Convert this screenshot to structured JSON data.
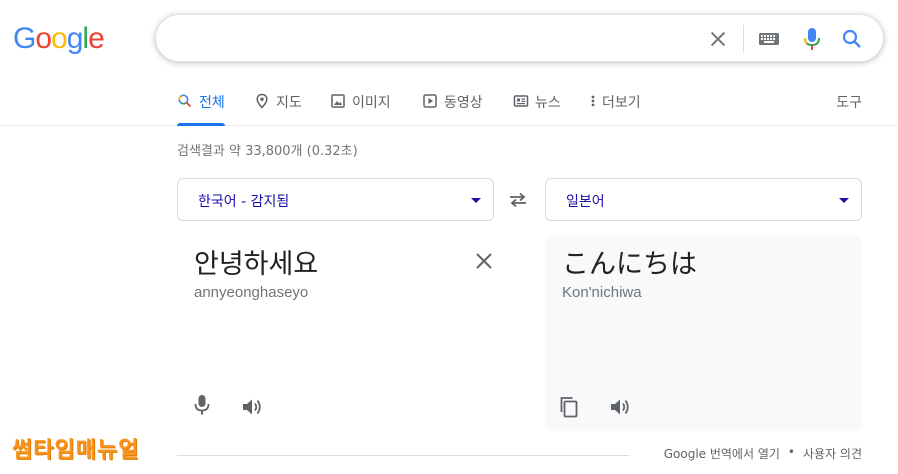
{
  "logo": {
    "letters": [
      "G",
      "o",
      "o",
      "g",
      "l",
      "e"
    ],
    "colors": [
      "#4285F4",
      "#EA4335",
      "#FBBC05",
      "#4285F4",
      "#34A853",
      "#EA4335"
    ]
  },
  "search": {
    "value": "",
    "placeholder": ""
  },
  "tabs": [
    {
      "label": "전체",
      "icon": "search-icon",
      "active": true
    },
    {
      "label": "지도",
      "icon": "map-pin-icon"
    },
    {
      "label": "이미지",
      "icon": "image-icon"
    },
    {
      "label": "동영상",
      "icon": "video-icon"
    },
    {
      "label": "뉴스",
      "icon": "news-icon"
    },
    {
      "label": "더보기",
      "icon": "more-icon"
    }
  ],
  "tools_label": "도구",
  "result_stats": "검색결과 약 33,800개 (0.32초)",
  "translator": {
    "source_lang": "한국어 - 감지됨",
    "target_lang": "일본어",
    "source_text": "안녕하세요",
    "source_romanization": "annyeonghaseyo",
    "target_text": "こんにちは",
    "target_romanization": "Kon'nichiwa"
  },
  "footer": {
    "open_label": "Google 번역에서 열기",
    "separator": "•",
    "feedback_label": "사용자 의견"
  },
  "watermark": "썸타임매뉴얼",
  "colors": {
    "accent": "#1a73e8",
    "link": "#1a0dab",
    "watermark": "#f7941d"
  }
}
